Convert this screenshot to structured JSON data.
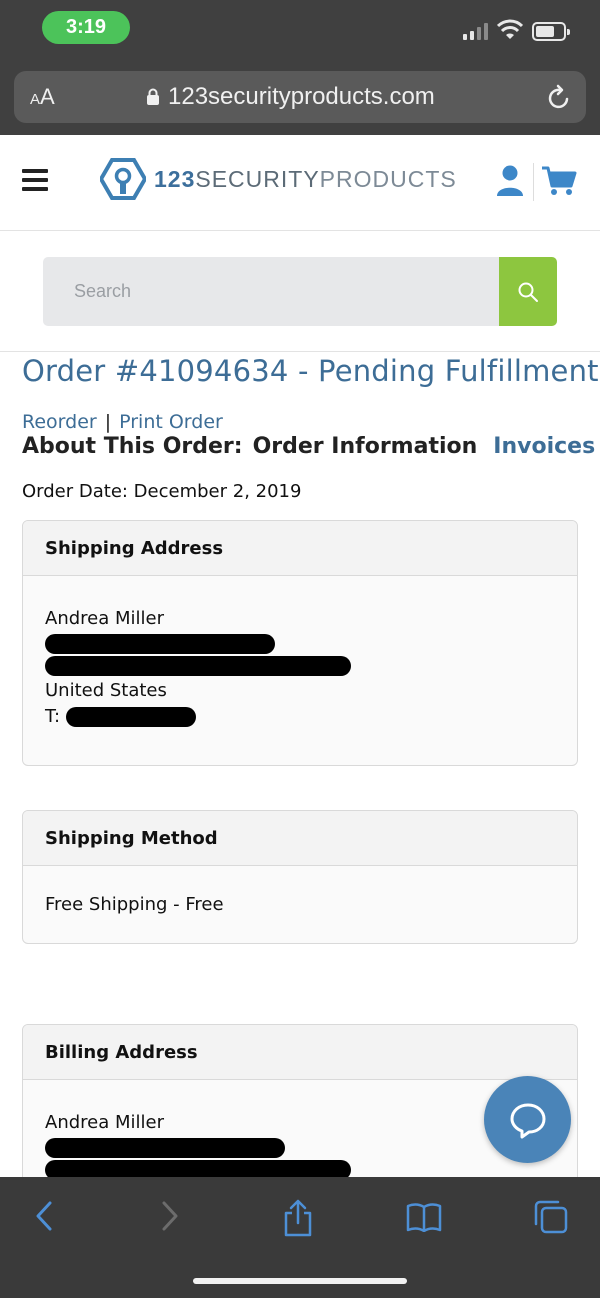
{
  "status_bar": {
    "time": "3:19"
  },
  "browser": {
    "aa_label_small": "A",
    "aa_label_large": "A",
    "url": "123securityproducts.com"
  },
  "site": {
    "logo_number": "123",
    "logo_security": "SECURITY",
    "logo_products": "PRODUCTS",
    "search_placeholder": "Search",
    "brand_green": "#8dc63f",
    "brand_blue": "#3d6d96"
  },
  "order": {
    "title": "Order #41094634 - Pending Fulfillment",
    "reorder_label": "Reorder",
    "separator": "|",
    "print_label": "Print Order",
    "about_label": "About This Order:",
    "info_tab": "Order Information",
    "invoices_tab": "Invoices",
    "order_date": "Order Date: December 2, 2019"
  },
  "shipping_address": {
    "heading": "Shipping Address",
    "name": "Andrea Miller",
    "country": "United States",
    "phone_prefix": "T:"
  },
  "shipping_method": {
    "heading": "Shipping Method",
    "value": "Free Shipping - Free"
  },
  "billing_address": {
    "heading": "Billing Address",
    "name": "Andrea Miller"
  }
}
